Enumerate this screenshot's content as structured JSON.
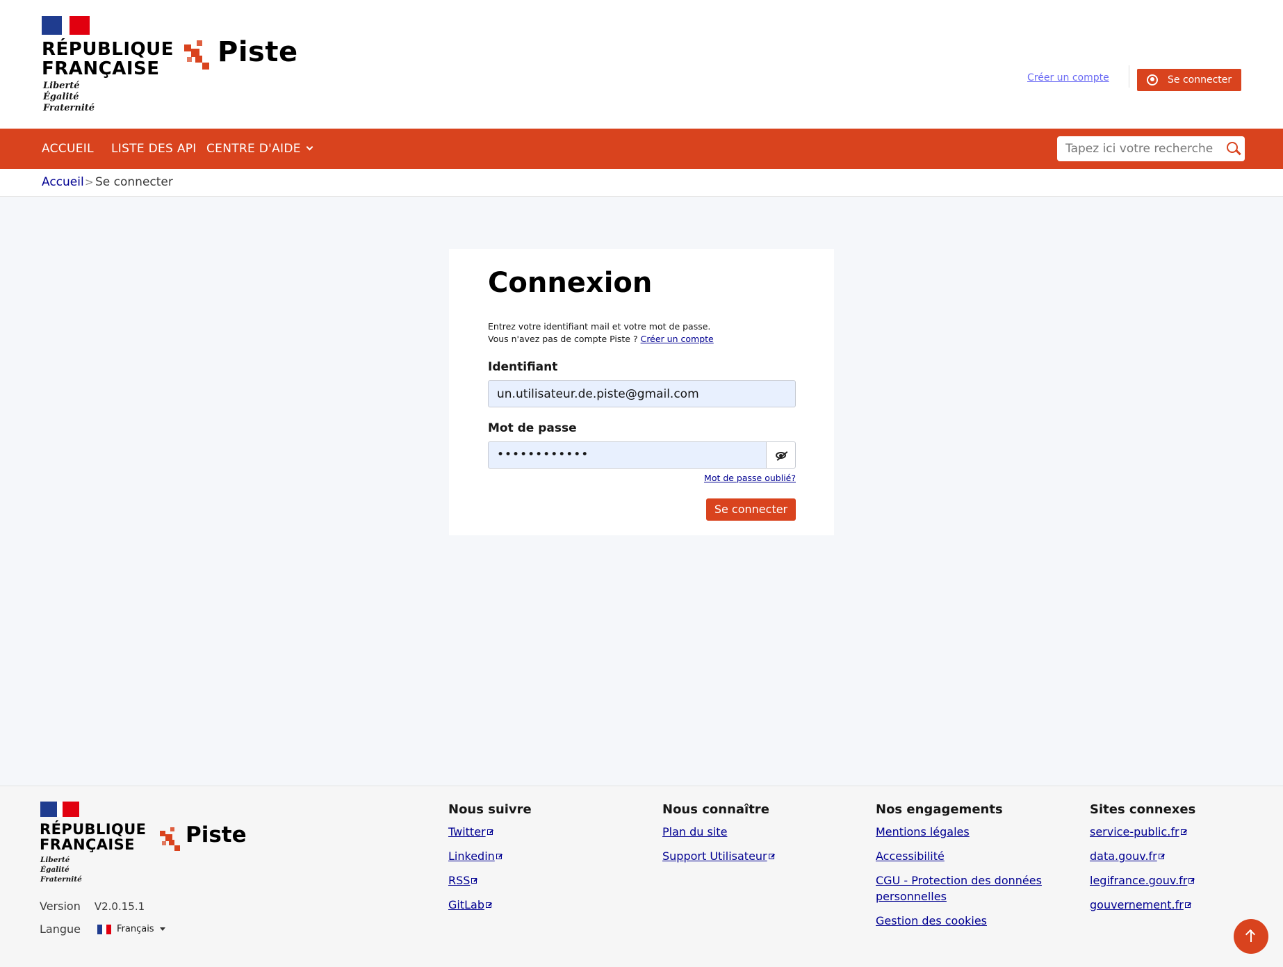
{
  "header": {
    "rf_title_line1": "RÉPUBLIQUE",
    "rf_title_line2": "FRANÇAISE",
    "motto_line1": "Liberté",
    "motto_line2": "Égalité",
    "motto_line3": "Fraternité",
    "brand": "Piste",
    "create_account": "Créer un compte",
    "login_button": "Se connecter",
    "accent_color": "#d9431e"
  },
  "nav": {
    "items": [
      {
        "label": "ACCUEIL"
      },
      {
        "label": "LISTE DES API"
      },
      {
        "label": "CENTRE D'AIDE"
      }
    ],
    "search_placeholder": "Tapez ici votre recherche ..."
  },
  "breadcrumb": {
    "home": "Accueil",
    "separator": ">",
    "current": "Se connecter"
  },
  "login_form": {
    "title": "Connexion",
    "intro_line1": "Entrez votre identifiant mail et votre mot de passe.",
    "intro_line2": "Vous n'avez pas de compte Piste ?",
    "intro_link": "Créer un compte",
    "identifier_label": "Identifiant",
    "identifier_value": "un.utilisateur.de.piste@gmail.com",
    "password_label": "Mot de passe",
    "password_value": "••••••••••••",
    "forgot_password": "Mot de passe oublié?",
    "submit": "Se connecter"
  },
  "footer": {
    "rf_title_line1": "RÉPUBLIQUE",
    "rf_title_line2": "FRANÇAISE",
    "motto_line1": "Liberté",
    "motto_line2": "Égalité",
    "motto_line3": "Fraternité",
    "brand": "Piste",
    "version_label": "Version",
    "version_value": "V2.0.15.1",
    "language_label": "Langue",
    "language_value": "Français",
    "columns": [
      {
        "title": "Nous suivre",
        "links": [
          "Twitter",
          "Linkedin",
          "RSS",
          "GitLab"
        ]
      },
      {
        "title": "Nous connaître",
        "links": [
          "Plan du site",
          "Support Utilisateur"
        ]
      },
      {
        "title": "Nos engagements",
        "links": [
          "Mentions légales",
          "Accessibilité",
          "CGU - Protection des données personnelles",
          "Gestion des cookies"
        ]
      },
      {
        "title": "Sites connexes",
        "links": [
          "service-public.fr",
          "data.gouv.fr",
          "legifrance.gouv.fr",
          "gouvernement.fr"
        ]
      }
    ]
  }
}
